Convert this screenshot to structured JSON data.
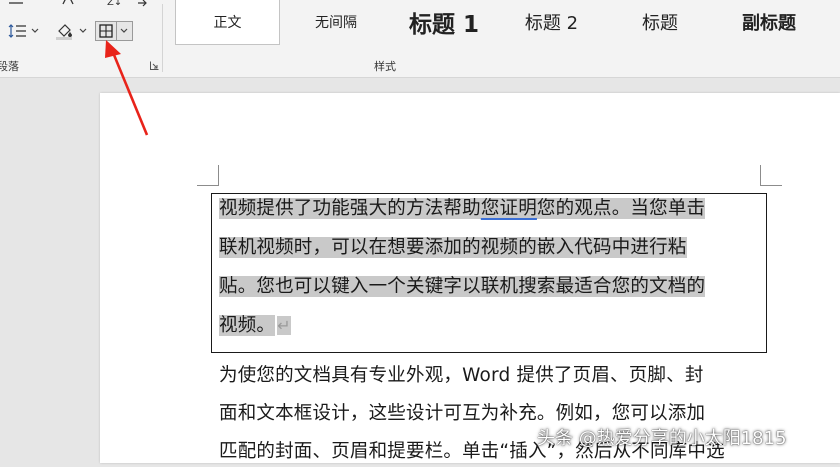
{
  "ribbon": {
    "paragraph_group_label": "段落",
    "styles_group_label": "样式",
    "styles": [
      {
        "label": "正文",
        "selected": true
      },
      {
        "label": "无间隔",
        "selected": false
      },
      {
        "label": "标题 1",
        "selected": false
      },
      {
        "label": "标题 2",
        "selected": false
      },
      {
        "label": "标题",
        "selected": false
      },
      {
        "label": "副标题",
        "selected": false
      }
    ],
    "icons": [
      "line-spacing-icon",
      "shading-icon",
      "borders-icon",
      "sort-icon",
      "paragraph-launcher-icon"
    ]
  },
  "document": {
    "paragraph1": {
      "line1_a": "视频提供了功能强大的方法帮助",
      "line1_b": "您证明",
      "line1_c": "您的观点。当您单击",
      "line2": "联机视频时，可以在想要添加的视频的嵌入代码中进行粘",
      "line3": "贴。您也可以键入一个关键字以联机搜索最适合您的文档的",
      "line4": "视频。",
      "para_mark": "↵"
    },
    "paragraph2": {
      "line1": "为使您的文档具有专业外观，Word 提供了页眉、页脚、封",
      "line2": "面和文本框设计，这些设计可互为补充。例如，您可以添加",
      "line3": "匹配的封面、页眉和提要栏。单击“插入”，然后从不同库中选"
    }
  },
  "watermark": "头条 @热爱分享的小太阳1815",
  "colors": {
    "selection": "#c9c9c9",
    "annotation_arrow": "#e8231a",
    "squiggle": "#3b6fd6"
  }
}
